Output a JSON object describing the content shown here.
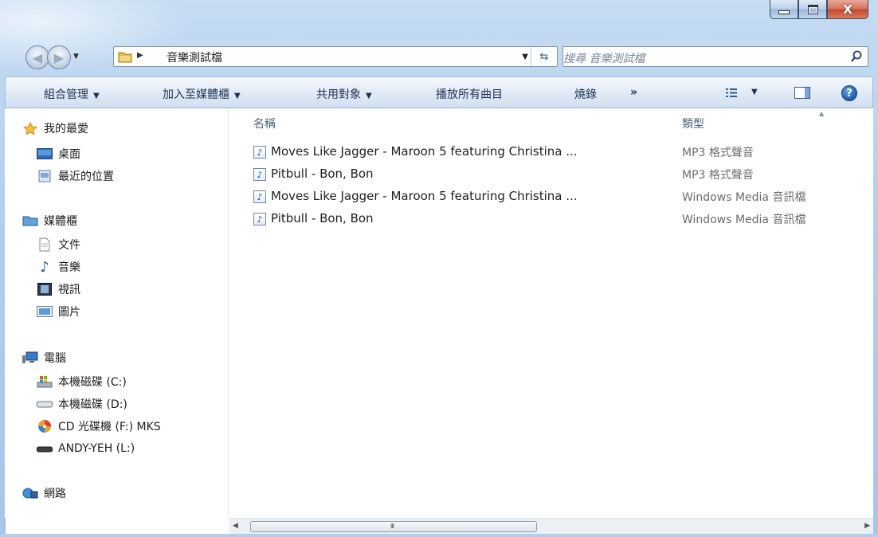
{
  "window": {
    "minimize_label": "_",
    "close_label": "X"
  },
  "address": {
    "separator": "▶",
    "path": "音樂測試檔"
  },
  "search": {
    "placeholder": "搜尋 音樂測試檔"
  },
  "commands": {
    "organize": "組合管理",
    "add_to_library": "加入至媒體櫃",
    "share": "共用對象",
    "play_all": "播放所有曲目",
    "burn": "燒錄",
    "more": "»"
  },
  "sidebar": {
    "favorites": {
      "label": "我的最愛",
      "items": [
        {
          "label": "桌面"
        },
        {
          "label": "最近的位置"
        }
      ]
    },
    "libraries": {
      "label": "媒體櫃",
      "items": [
        {
          "label": "文件"
        },
        {
          "label": "音樂"
        },
        {
          "label": "視訊"
        },
        {
          "label": "圖片"
        }
      ]
    },
    "computer": {
      "label": "電腦",
      "items": [
        {
          "label": "本機磁碟 (C:)"
        },
        {
          "label": "本機磁碟 (D:)"
        },
        {
          "label": "CD 光碟機 (F:) MKS"
        },
        {
          "label": "ANDY-YEH (L:)"
        }
      ]
    },
    "network": {
      "label": "網路"
    }
  },
  "columns": {
    "name": "名稱",
    "type": "類型"
  },
  "files": [
    {
      "name": "Moves Like Jagger - Maroon 5 featuring Christina ...",
      "type": "MP3 格式聲音"
    },
    {
      "name": "Pitbull - Bon, Bon",
      "type": "MP3 格式聲音"
    },
    {
      "name": "Moves Like Jagger - Maroon 5 featuring Christina ...",
      "type": "Windows Media 音訊檔"
    },
    {
      "name": "Pitbull - Bon, Bon",
      "type": "Windows Media 音訊檔"
    }
  ],
  "scrollbar": {
    "grip": "III"
  },
  "help": {
    "label": "?"
  },
  "colors": {
    "frame": "#b3cfee",
    "accent": "#1a4f96",
    "type_text": "#6d6d6d"
  }
}
